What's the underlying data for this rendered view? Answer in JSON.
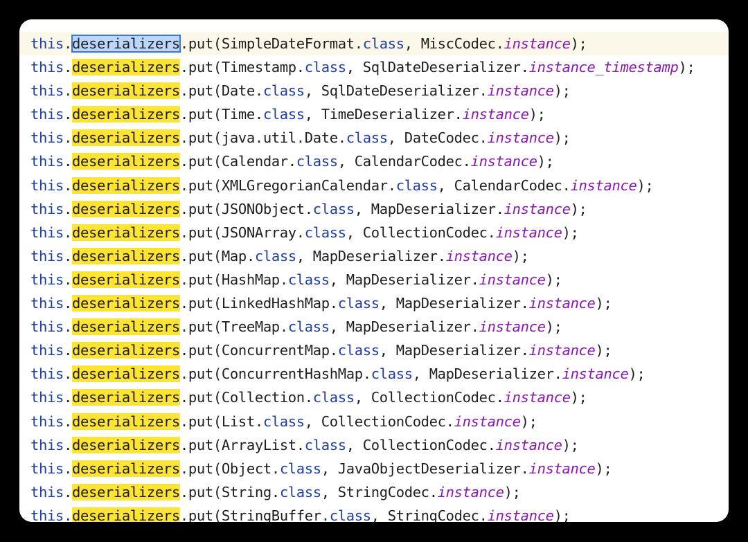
{
  "editor": {
    "lines": [
      {
        "prefix": "this",
        "field": "deserializers",
        "method": "put",
        "type": "SimpleDateFormat",
        "cls": "class",
        "target": "MiscCodec",
        "inst": "instance",
        "selected": true
      },
      {
        "prefix": "this",
        "field": "deserializers",
        "method": "put",
        "type": "Timestamp",
        "cls": "class",
        "target": "SqlDateDeserializer",
        "inst": "instance_timestamp"
      },
      {
        "prefix": "this",
        "field": "deserializers",
        "method": "put",
        "type": "Date",
        "cls": "class",
        "target": "SqlDateDeserializer",
        "inst": "instance"
      },
      {
        "prefix": "this",
        "field": "deserializers",
        "method": "put",
        "type": "Time",
        "cls": "class",
        "target": "TimeDeserializer",
        "inst": "instance"
      },
      {
        "prefix": "this",
        "field": "deserializers",
        "method": "put",
        "type": "java.util.Date",
        "cls": "class",
        "target": "DateCodec",
        "inst": "instance"
      },
      {
        "prefix": "this",
        "field": "deserializers",
        "method": "put",
        "type": "Calendar",
        "cls": "class",
        "target": "CalendarCodec",
        "inst": "instance"
      },
      {
        "prefix": "this",
        "field": "deserializers",
        "method": "put",
        "type": "XMLGregorianCalendar",
        "cls": "class",
        "target": "CalendarCodec",
        "inst": "instance"
      },
      {
        "prefix": "this",
        "field": "deserializers",
        "method": "put",
        "type": "JSONObject",
        "cls": "class",
        "target": "MapDeserializer",
        "inst": "instance"
      },
      {
        "prefix": "this",
        "field": "deserializers",
        "method": "put",
        "type": "JSONArray",
        "cls": "class",
        "target": "CollectionCodec",
        "inst": "instance"
      },
      {
        "prefix": "this",
        "field": "deserializers",
        "method": "put",
        "type": "Map",
        "cls": "class",
        "target": "MapDeserializer",
        "inst": "instance"
      },
      {
        "prefix": "this",
        "field": "deserializers",
        "method": "put",
        "type": "HashMap",
        "cls": "class",
        "target": "MapDeserializer",
        "inst": "instance"
      },
      {
        "prefix": "this",
        "field": "deserializers",
        "method": "put",
        "type": "LinkedHashMap",
        "cls": "class",
        "target": "MapDeserializer",
        "inst": "instance"
      },
      {
        "prefix": "this",
        "field": "deserializers",
        "method": "put",
        "type": "TreeMap",
        "cls": "class",
        "target": "MapDeserializer",
        "inst": "instance"
      },
      {
        "prefix": "this",
        "field": "deserializers",
        "method": "put",
        "type": "ConcurrentMap",
        "cls": "class",
        "target": "MapDeserializer",
        "inst": "instance"
      },
      {
        "prefix": "this",
        "field": "deserializers",
        "method": "put",
        "type": "ConcurrentHashMap",
        "cls": "class",
        "target": "MapDeserializer",
        "inst": "instance"
      },
      {
        "prefix": "this",
        "field": "deserializers",
        "method": "put",
        "type": "Collection",
        "cls": "class",
        "target": "CollectionCodec",
        "inst": "instance"
      },
      {
        "prefix": "this",
        "field": "deserializers",
        "method": "put",
        "type": "List",
        "cls": "class",
        "target": "CollectionCodec",
        "inst": "instance"
      },
      {
        "prefix": "this",
        "field": "deserializers",
        "method": "put",
        "type": "ArrayList",
        "cls": "class",
        "target": "CollectionCodec",
        "inst": "instance"
      },
      {
        "prefix": "this",
        "field": "deserializers",
        "method": "put",
        "type": "Object",
        "cls": "class",
        "target": "JavaObjectDeserializer",
        "inst": "instance"
      },
      {
        "prefix": "this",
        "field": "deserializers",
        "method": "put",
        "type": "String",
        "cls": "class",
        "target": "StringCodec",
        "inst": "instance"
      },
      {
        "prefix": "this",
        "field": "deserializers",
        "method": "put",
        "type": "StringBuffer",
        "cls": "class",
        "target": "StringCodec",
        "inst": "instance"
      }
    ]
  }
}
